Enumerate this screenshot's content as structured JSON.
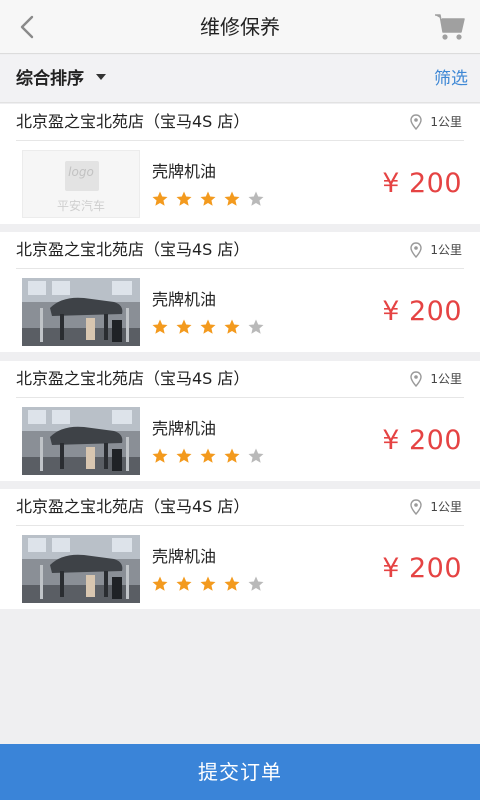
{
  "header": {
    "title": "维修保养"
  },
  "filter": {
    "sort_label": "综合排序",
    "filter_label": "筛选"
  },
  "shops": [
    {
      "name": "北京盈之宝北苑店（宝马4S 店）",
      "distance": "1公里",
      "product": "壳牌机油",
      "price": "¥ 200",
      "rating": 4,
      "max_rating": 5,
      "image": "logo-placeholder",
      "logo_text": "logo",
      "logo_sub": "平安汽车"
    },
    {
      "name": "北京盈之宝北苑店（宝马4S 店）",
      "distance": "1公里",
      "product": "壳牌机油",
      "price": "¥ 200",
      "rating": 4,
      "max_rating": 5,
      "image": "garage-photo"
    },
    {
      "name": "北京盈之宝北苑店（宝马4S 店）",
      "distance": "1公里",
      "product": "壳牌机油",
      "price": "¥ 200",
      "rating": 4,
      "max_rating": 5,
      "image": "garage-photo"
    },
    {
      "name": "北京盈之宝北苑店（宝马4S 店）",
      "distance": "1公里",
      "product": "壳牌机油",
      "price": "¥ 200",
      "rating": 4,
      "max_rating": 5,
      "image": "garage-photo"
    }
  ],
  "footer": {
    "submit_label": "提交订单"
  },
  "colors": {
    "accent": "#3a84d8",
    "price": "#e54343",
    "star_on": "#f39a1e",
    "star_off": "#b9b9b9"
  }
}
